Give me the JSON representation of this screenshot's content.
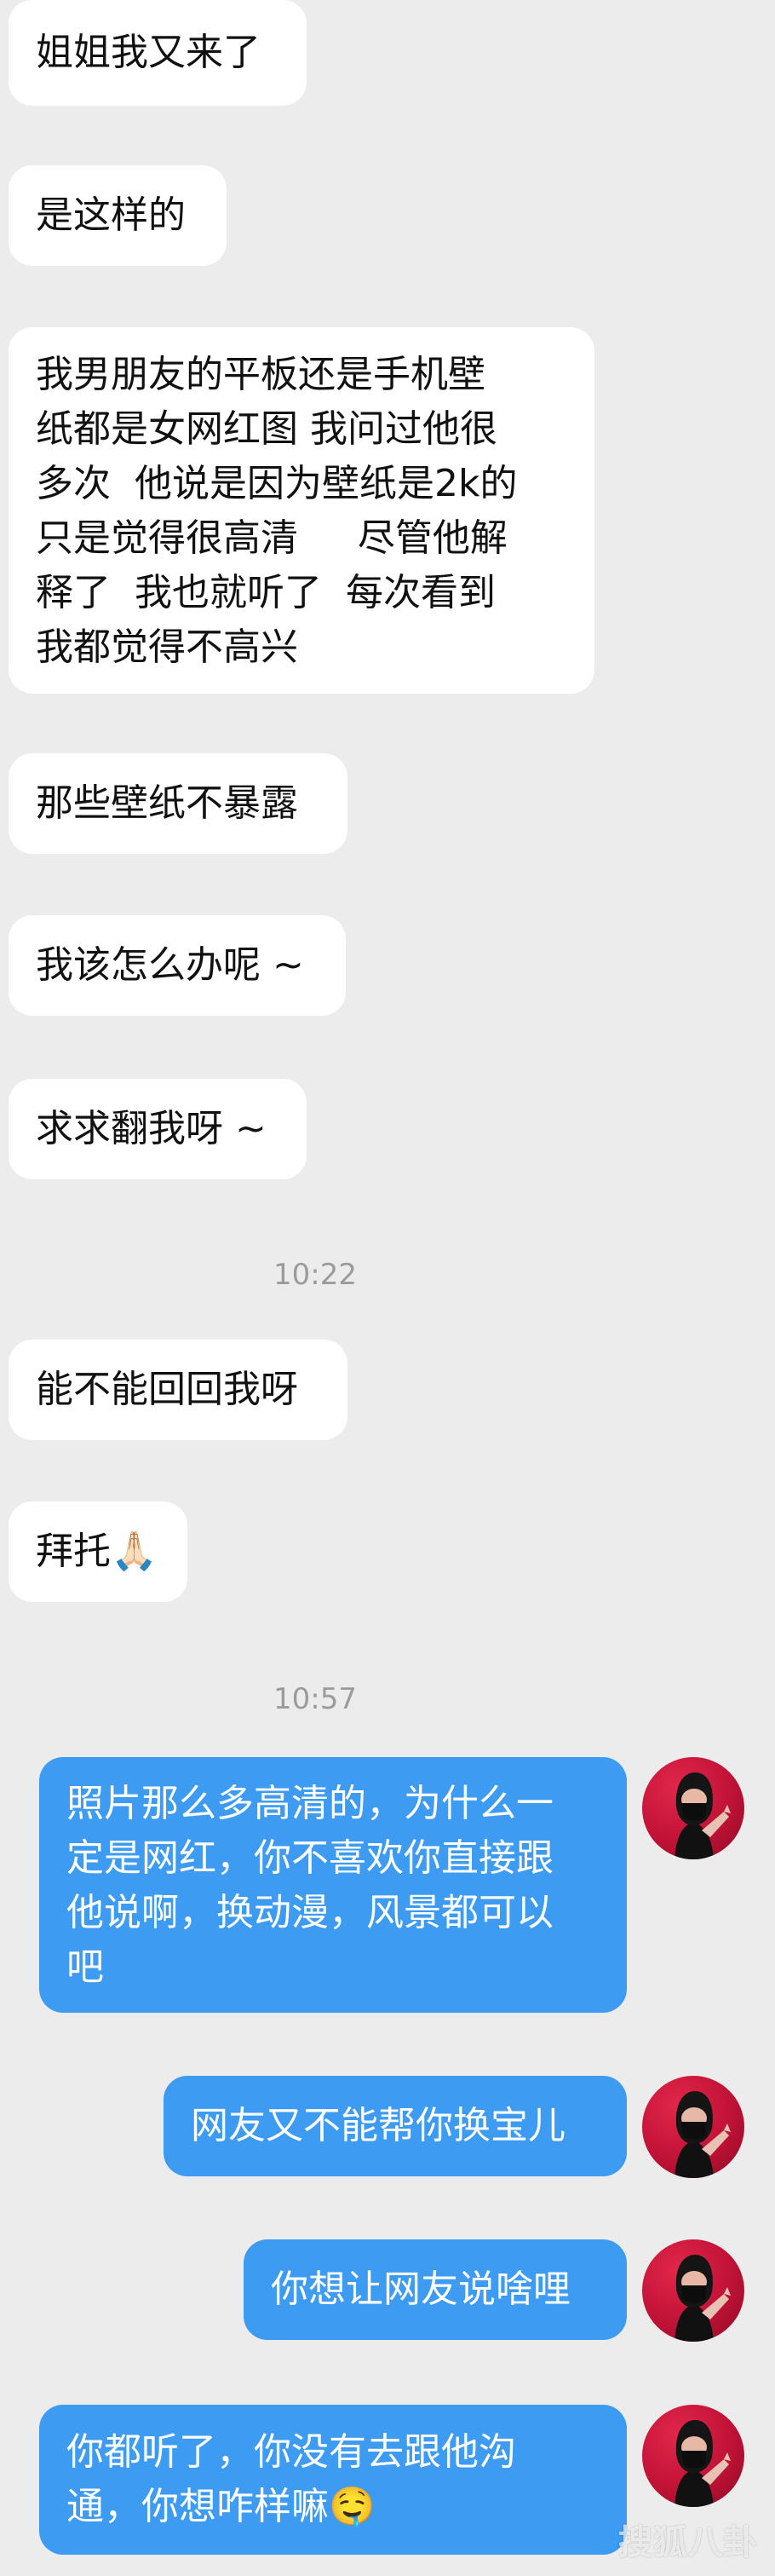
{
  "messages": {
    "m1": "姐姐我又来了",
    "m2": "是这样的",
    "m3": "我男朋友的平板还是手机壁\n纸都是女网红图 我问过他很\n多次  他说是因为壁纸是2k的\n只是觉得很高清     尽管他解\n释了  我也就听了  每次看到\n我都觉得不高兴",
    "m4": "那些壁纸不暴露",
    "m5": "我该怎么办呢 ~",
    "m6": "求求翻我呀 ~",
    "m7": "能不能回回我呀",
    "m8": "拜托🙏🏻",
    "m9": "照片那么多高清的，为什么一\n定是网红，你不喜欢你直接跟\n他说啊，换动漫，风景都可以\n吧",
    "m10": "网友又不能帮你换宝儿",
    "m11": "你想让网友说啥哩",
    "m12": "你都听了，你没有去跟他沟\n通，你想咋样嘛🤤"
  },
  "timestamps": {
    "t1": "10:22",
    "t2": "10:57"
  },
  "watermark": "搜狐八卦",
  "colors": {
    "background": "#ececec",
    "incoming_bubble": "#ffffff",
    "outgoing_bubble": "#3d9bf2"
  },
  "icons": {
    "avatar": "masked-woman-avatar"
  }
}
